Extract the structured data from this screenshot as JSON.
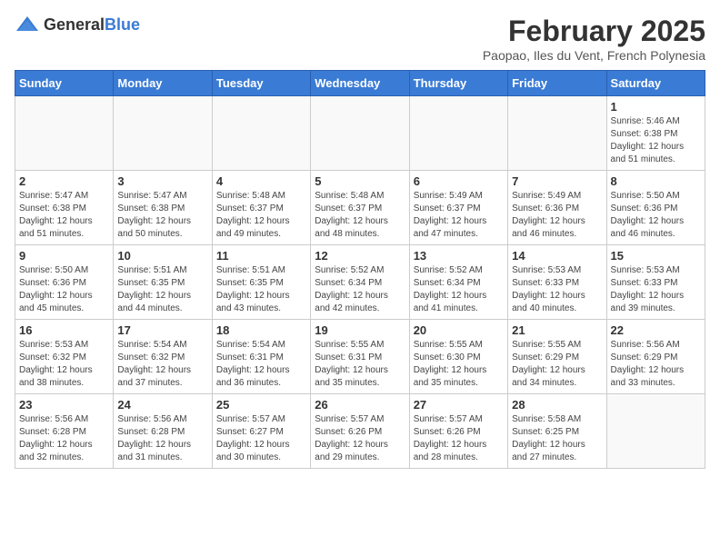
{
  "logo": {
    "text_general": "General",
    "text_blue": "Blue"
  },
  "header": {
    "title": "February 2025",
    "subtitle": "Paopao, Iles du Vent, French Polynesia"
  },
  "weekdays": [
    "Sunday",
    "Monday",
    "Tuesday",
    "Wednesday",
    "Thursday",
    "Friday",
    "Saturday"
  ],
  "weeks": [
    [
      {
        "day": "",
        "info": ""
      },
      {
        "day": "",
        "info": ""
      },
      {
        "day": "",
        "info": ""
      },
      {
        "day": "",
        "info": ""
      },
      {
        "day": "",
        "info": ""
      },
      {
        "day": "",
        "info": ""
      },
      {
        "day": "1",
        "info": "Sunrise: 5:46 AM\nSunset: 6:38 PM\nDaylight: 12 hours\nand 51 minutes."
      }
    ],
    [
      {
        "day": "2",
        "info": "Sunrise: 5:47 AM\nSunset: 6:38 PM\nDaylight: 12 hours\nand 51 minutes."
      },
      {
        "day": "3",
        "info": "Sunrise: 5:47 AM\nSunset: 6:38 PM\nDaylight: 12 hours\nand 50 minutes."
      },
      {
        "day": "4",
        "info": "Sunrise: 5:48 AM\nSunset: 6:37 PM\nDaylight: 12 hours\nand 49 minutes."
      },
      {
        "day": "5",
        "info": "Sunrise: 5:48 AM\nSunset: 6:37 PM\nDaylight: 12 hours\nand 48 minutes."
      },
      {
        "day": "6",
        "info": "Sunrise: 5:49 AM\nSunset: 6:37 PM\nDaylight: 12 hours\nand 47 minutes."
      },
      {
        "day": "7",
        "info": "Sunrise: 5:49 AM\nSunset: 6:36 PM\nDaylight: 12 hours\nand 46 minutes."
      },
      {
        "day": "8",
        "info": "Sunrise: 5:50 AM\nSunset: 6:36 PM\nDaylight: 12 hours\nand 46 minutes."
      }
    ],
    [
      {
        "day": "9",
        "info": "Sunrise: 5:50 AM\nSunset: 6:36 PM\nDaylight: 12 hours\nand 45 minutes."
      },
      {
        "day": "10",
        "info": "Sunrise: 5:51 AM\nSunset: 6:35 PM\nDaylight: 12 hours\nand 44 minutes."
      },
      {
        "day": "11",
        "info": "Sunrise: 5:51 AM\nSunset: 6:35 PM\nDaylight: 12 hours\nand 43 minutes."
      },
      {
        "day": "12",
        "info": "Sunrise: 5:52 AM\nSunset: 6:34 PM\nDaylight: 12 hours\nand 42 minutes."
      },
      {
        "day": "13",
        "info": "Sunrise: 5:52 AM\nSunset: 6:34 PM\nDaylight: 12 hours\nand 41 minutes."
      },
      {
        "day": "14",
        "info": "Sunrise: 5:53 AM\nSunset: 6:33 PM\nDaylight: 12 hours\nand 40 minutes."
      },
      {
        "day": "15",
        "info": "Sunrise: 5:53 AM\nSunset: 6:33 PM\nDaylight: 12 hours\nand 39 minutes."
      }
    ],
    [
      {
        "day": "16",
        "info": "Sunrise: 5:53 AM\nSunset: 6:32 PM\nDaylight: 12 hours\nand 38 minutes."
      },
      {
        "day": "17",
        "info": "Sunrise: 5:54 AM\nSunset: 6:32 PM\nDaylight: 12 hours\nand 37 minutes."
      },
      {
        "day": "18",
        "info": "Sunrise: 5:54 AM\nSunset: 6:31 PM\nDaylight: 12 hours\nand 36 minutes."
      },
      {
        "day": "19",
        "info": "Sunrise: 5:55 AM\nSunset: 6:31 PM\nDaylight: 12 hours\nand 35 minutes."
      },
      {
        "day": "20",
        "info": "Sunrise: 5:55 AM\nSunset: 6:30 PM\nDaylight: 12 hours\nand 35 minutes."
      },
      {
        "day": "21",
        "info": "Sunrise: 5:55 AM\nSunset: 6:29 PM\nDaylight: 12 hours\nand 34 minutes."
      },
      {
        "day": "22",
        "info": "Sunrise: 5:56 AM\nSunset: 6:29 PM\nDaylight: 12 hours\nand 33 minutes."
      }
    ],
    [
      {
        "day": "23",
        "info": "Sunrise: 5:56 AM\nSunset: 6:28 PM\nDaylight: 12 hours\nand 32 minutes."
      },
      {
        "day": "24",
        "info": "Sunrise: 5:56 AM\nSunset: 6:28 PM\nDaylight: 12 hours\nand 31 minutes."
      },
      {
        "day": "25",
        "info": "Sunrise: 5:57 AM\nSunset: 6:27 PM\nDaylight: 12 hours\nand 30 minutes."
      },
      {
        "day": "26",
        "info": "Sunrise: 5:57 AM\nSunset: 6:26 PM\nDaylight: 12 hours\nand 29 minutes."
      },
      {
        "day": "27",
        "info": "Sunrise: 5:57 AM\nSunset: 6:26 PM\nDaylight: 12 hours\nand 28 minutes."
      },
      {
        "day": "28",
        "info": "Sunrise: 5:58 AM\nSunset: 6:25 PM\nDaylight: 12 hours\nand 27 minutes."
      },
      {
        "day": "",
        "info": ""
      }
    ]
  ]
}
